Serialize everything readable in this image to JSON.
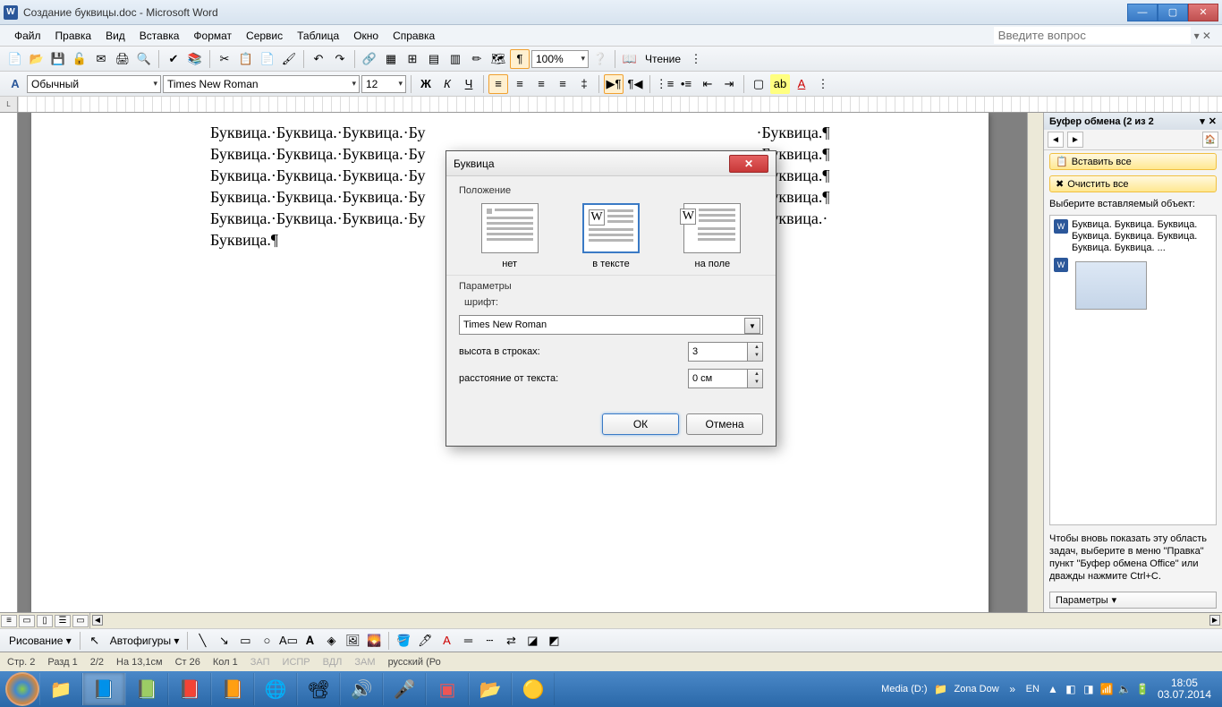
{
  "titlebar": {
    "app_icon": "W",
    "title": "Создание буквицы.doc - Microsoft Word"
  },
  "menubar": {
    "items": [
      "Файл",
      "Правка",
      "Вид",
      "Вставка",
      "Формат",
      "Сервис",
      "Таблица",
      "Окно",
      "Справка"
    ],
    "help_placeholder": "Введите вопрос"
  },
  "toolbar_std": {
    "zoom": "100%",
    "reading": "Чтение"
  },
  "toolbar_fmt": {
    "style": "Обычный",
    "font": "Times New Roman",
    "size": "12"
  },
  "ruler": {
    "corner": "L"
  },
  "document": {
    "lines": [
      "Буквица.·Буквица.·Буквица.·Бу",
      "Буквица.·Буквица.·Буквица.·Бу",
      "Буквица.·Буквица.·Буквица.·Бу",
      "Буквица.·Буквица.·Буквица.·Бу",
      "Буквица.·Буквица.·Буквица.·Бу",
      "Буквица.¶"
    ],
    "tail": [
      "·Буквица.¶",
      "·Буквица.¶",
      "·Буквица.¶",
      "·Буквица.¶",
      "·Буквица.·"
    ]
  },
  "sidepanel": {
    "title": "Буфер обмена (2 из 2",
    "paste_all": "Вставить все",
    "clear_all": "Очистить все",
    "choose_label": "Выберите вставляемый объект:",
    "item_text": "Буквица. Буквица. Буквица. Буквица. Буквица. Буквица. Буквица. Буквица. ...",
    "hint": "Чтобы вновь показать эту область задач, выберите в меню \"Правка\" пункт \"Буфер обмена Office\" или дважды нажмите Ctrl+C.",
    "options": "Параметры"
  },
  "dialog": {
    "title": "Буквица",
    "section_position": "Положение",
    "opt_none": "нет",
    "opt_intext": "в тексте",
    "opt_margin": "на поле",
    "section_params": "Параметры",
    "font_label": "шрифт:",
    "font_value": "Times New Roman",
    "lines_label": "высота в строках:",
    "lines_value": "3",
    "dist_label": "расстояние от текста:",
    "dist_value": "0 см",
    "ok": "ОК",
    "cancel": "Отмена"
  },
  "drawbar": {
    "drawing": "Рисование",
    "autoshapes": "Автофигуры"
  },
  "statusbar": {
    "page": "Стр. 2",
    "section": "Разд 1",
    "pages": "2/2",
    "at": "На 13,1см",
    "line": "Ст 26",
    "col": "Кол 1",
    "rec": "ЗАП",
    "trk": "ИСПР",
    "ext": "ВДЛ",
    "ovr": "ЗАМ",
    "lang": "русский (Ро"
  },
  "taskbar": {
    "media": "Media (D:)",
    "zona": "Zona Dow",
    "lang": "EN",
    "time": "18:05",
    "date": "03.07.2014"
  }
}
